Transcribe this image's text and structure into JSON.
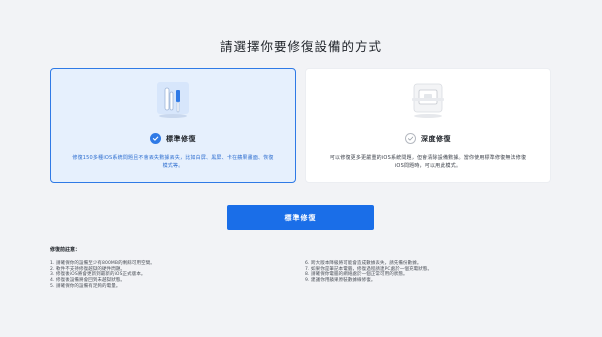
{
  "title": "請選擇你要修復設備的方式",
  "cards": [
    {
      "name": "標準修復",
      "description": "修復150多種iOS系統問題且不會丟失數據丟失，比如白屏、黑屏、卡在蘋果畫面、恢復模式等。",
      "selected": true,
      "icon": "tools-icon"
    },
    {
      "name": "深度修復",
      "description": "可以修復更多更嚴重的iOS系統問題，但會清除設備數據。當你使用標準修復無法修復iOS問題時，可以用此模式。",
      "selected": false,
      "icon": "device-icon"
    }
  ],
  "action_button": "標準修復",
  "notes": {
    "title": "修復前註意：",
    "left": [
      "1. 請確保你的設備至少有800MB的剩餘可用空間。",
      "2. 軟件不支持修復越獄的硬件問題。",
      "3. 修復後iOS將會更新到最新的iOS正式版本。",
      "4. 修復後設備將會回到未越獄狀態。",
      "5. 請確保你的設備有足夠的電量。"
    ],
    "right": [
      "6. 跨大版本降級將可能會造成數據丟失，請先備份數據。",
      "7. 如果你是筆記本電腦，修復過程請連PC處於一個充電狀態。",
      "8. 請確保你電腦的網絡處於一個正常可用的狀態。",
      "9. 建議你用蘋果原裝數據線修復。"
    ]
  },
  "colors": {
    "accent": "#1a6ee8",
    "selected_bg": "#e6f0fd",
    "page_bg": "#f2f3f6"
  }
}
